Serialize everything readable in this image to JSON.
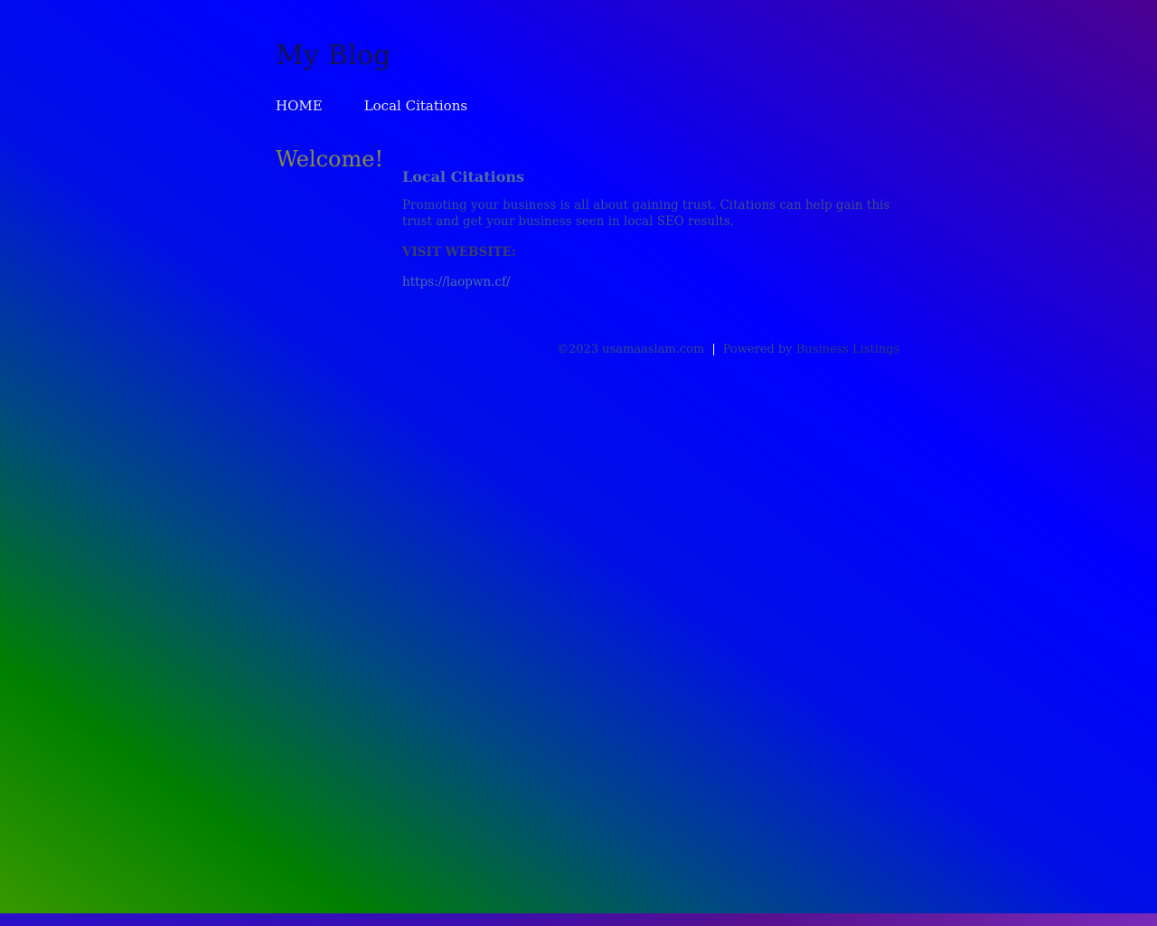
{
  "header": {
    "site_title": "My Blog"
  },
  "nav": {
    "items": [
      {
        "label": "HOME"
      },
      {
        "label": "Local Citations"
      }
    ]
  },
  "sidebar": {
    "welcome": "Welcome!"
  },
  "post": {
    "title": "Local Citations",
    "body": "Promoting your business is all about gaining trust. Citations can help gain this trust and get your business seen in local SEO results.",
    "visit_label": "VISIT WEBSITE:",
    "link": "https://laopwn.cf/"
  },
  "footer": {
    "copyright": "©2023 usamaaslam.com",
    "separator": "|",
    "powered_by": "Powered by",
    "powered_link": "Business Listings"
  }
}
